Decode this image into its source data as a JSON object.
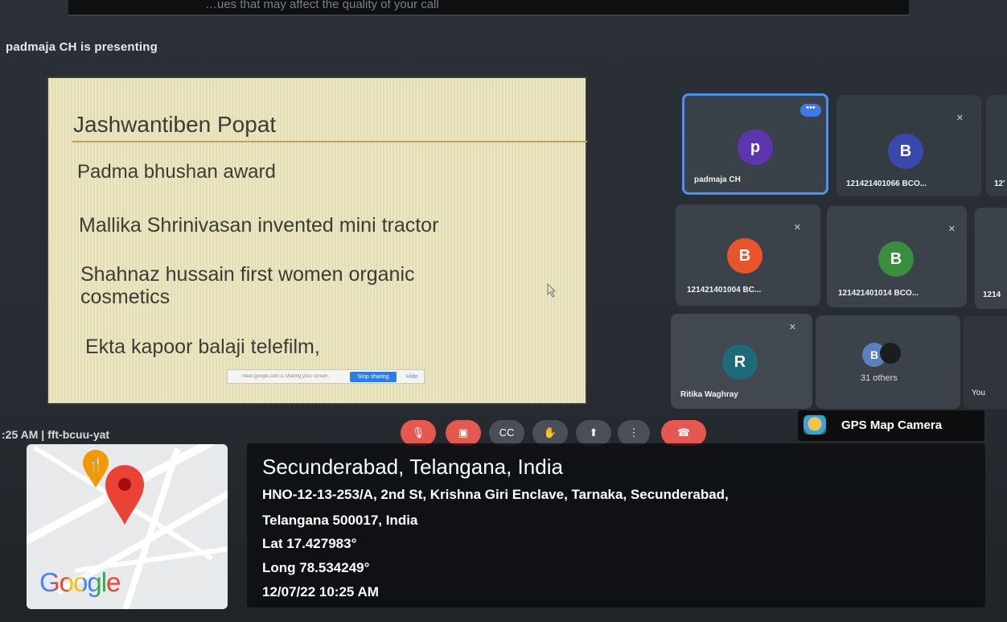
{
  "meet": {
    "top_notice": "…ues that may affect the quality of your call",
    "presenting": "padmaja CH is presenting",
    "meeting_code": ":25 AM  |  fft-bcuu-yat"
  },
  "slide": {
    "title": "Jashwantiben Popat",
    "lines": [
      "Padma bhushan award",
      "Mallika Shrinivasan invented mini tractor",
      "Shahnaz hussain first women organic cosmetics",
      "Ekta kapoor balaji telefilm,"
    ],
    "share_bar": {
      "text": "meet.google.com is sharing your screen.",
      "stop_label": "Stop sharing",
      "hide_label": "Hide"
    }
  },
  "participants": [
    {
      "initial": "p",
      "name": "padmaja CH",
      "color": "#5e35b1"
    },
    {
      "initial": "B",
      "name": "121421401066 BCO...",
      "color": "#3949ab"
    },
    {
      "initial": "B",
      "name": "121421401004 BC...",
      "color": "#e8552b"
    },
    {
      "initial": "B",
      "name": "121421401014 BCO...",
      "color": "#388e3c"
    },
    {
      "initial": "R",
      "name": "Ritika Waghray",
      "color": "#1d6a78"
    },
    {
      "initial": "B",
      "name": "31 others",
      "color": "#5c7fbf"
    }
  ],
  "edge_labels": {
    "c1": "12'",
    "c2": "1214",
    "you": "You"
  },
  "controls": [
    "mic-off",
    "camera-off",
    "captions",
    "raise-hand",
    "present",
    "more",
    "end-call"
  ],
  "gps": {
    "badge": "GPS Map Camera",
    "map_logo": "Google",
    "location": "Secunderabad, Telangana, India",
    "address_line1": "HNO-12-13-253/A, 2nd St, Krishna Giri Enclave, Tarnaka, Secunderabad,",
    "address_line2": "Telangana 500017, India",
    "lat": "Lat 17.427983°",
    "long": "Long 78.534249°",
    "datetime": "12/07/22 10:25 AM"
  },
  "colors": {
    "accent": "#4f8ef2",
    "end_call": "#e5584f"
  }
}
